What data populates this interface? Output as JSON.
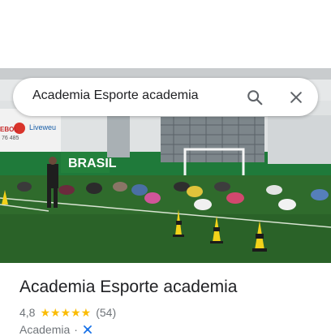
{
  "search": {
    "query": "Academia Esporte academia"
  },
  "photo": {
    "banner_text": "BRASIL",
    "ad_text": "Liveweu",
    "ad_text_left": "EBOL",
    "ad_phone": "76 485"
  },
  "place": {
    "title": "Academia Esporte academia",
    "rating": "4,8",
    "stars": "★★★★★",
    "review_count": "(54)",
    "category": "Academia",
    "separator": "·"
  },
  "icons": {
    "search": "search-icon",
    "close": "close-icon",
    "sport": "sport-icon"
  },
  "colors": {
    "star": "#fbbc04",
    "turf": "#2f6b2c",
    "text_primary": "#202124",
    "text_secondary": "#70757a"
  }
}
